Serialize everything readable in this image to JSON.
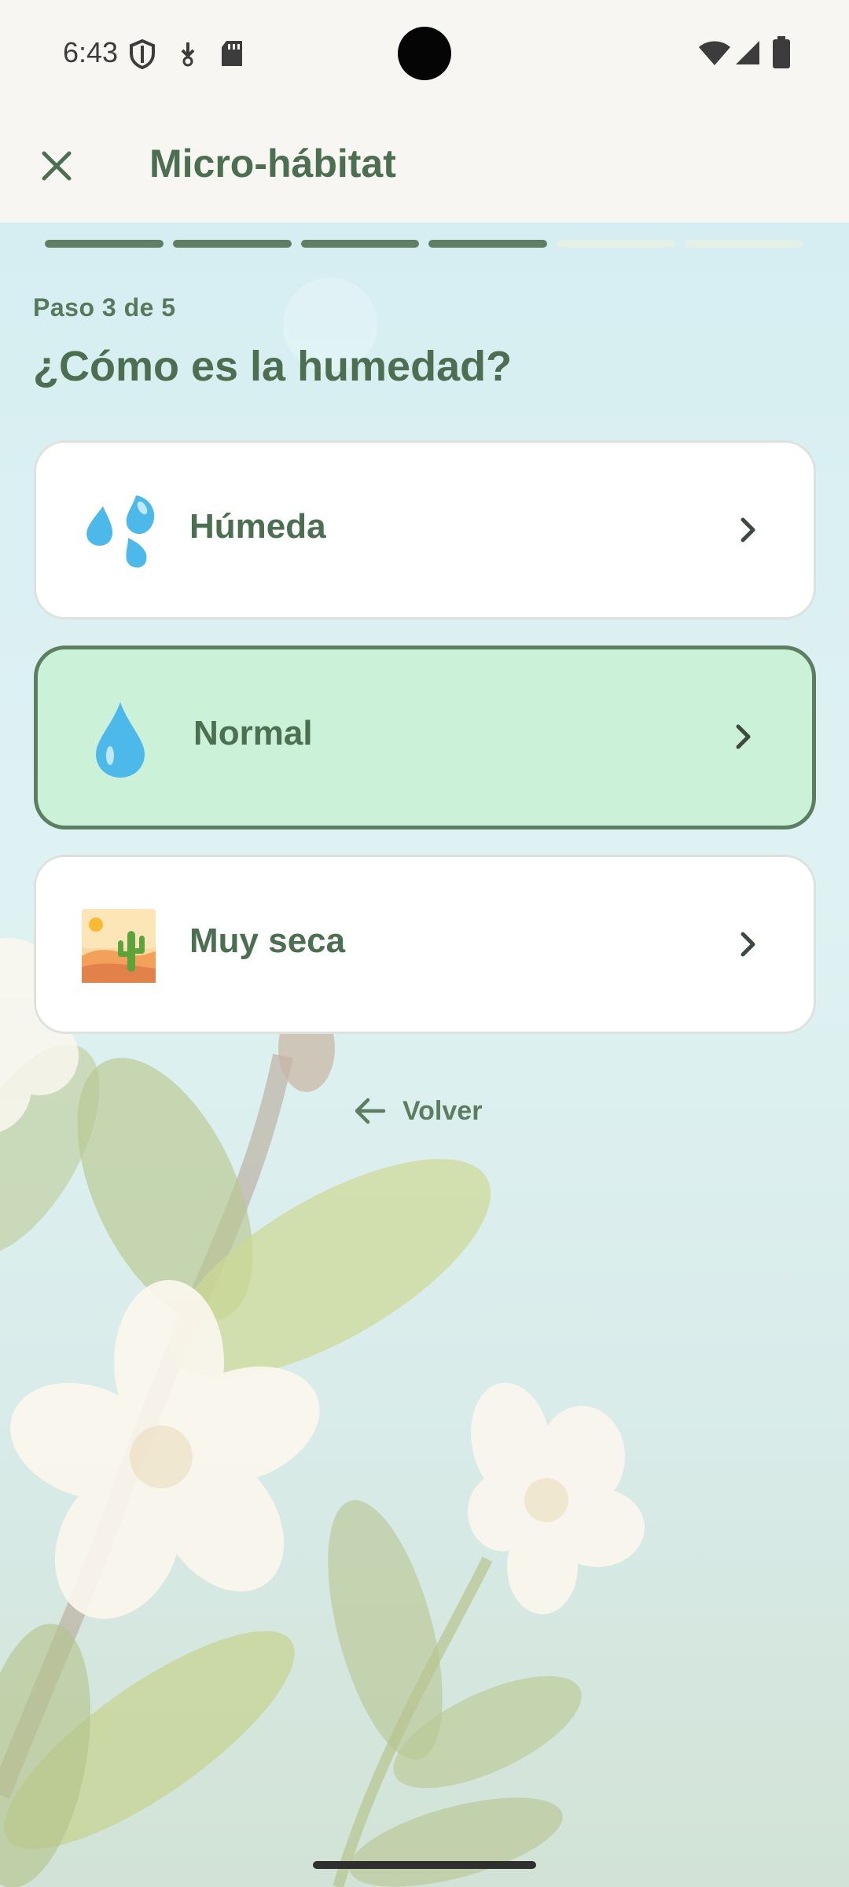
{
  "status_bar": {
    "time": "6:43",
    "icons": [
      "shield-icon",
      "download-icon",
      "sd-card-icon",
      "wifi-icon",
      "signal-icon",
      "battery-icon"
    ]
  },
  "app_bar": {
    "close_icon": "close-icon",
    "title": "Micro-hábitat"
  },
  "progress": {
    "total_steps": 6,
    "completed_steps": 4
  },
  "step": {
    "label": "Paso 3 de 5",
    "question": "¿Cómo es la humedad?"
  },
  "options": [
    {
      "label": "Húmeda",
      "icon": "sweat-droplets-icon",
      "selected": false
    },
    {
      "label": "Normal",
      "icon": "droplet-icon",
      "selected": true
    },
    {
      "label": "Muy seca",
      "icon": "desert-icon",
      "selected": false
    }
  ],
  "back": {
    "label": "Volver",
    "icon": "arrow-left-icon"
  },
  "colors": {
    "accent": "#4c6e51",
    "selected_bg": "#cbf1d9",
    "progress_done": "#5e7f62"
  }
}
